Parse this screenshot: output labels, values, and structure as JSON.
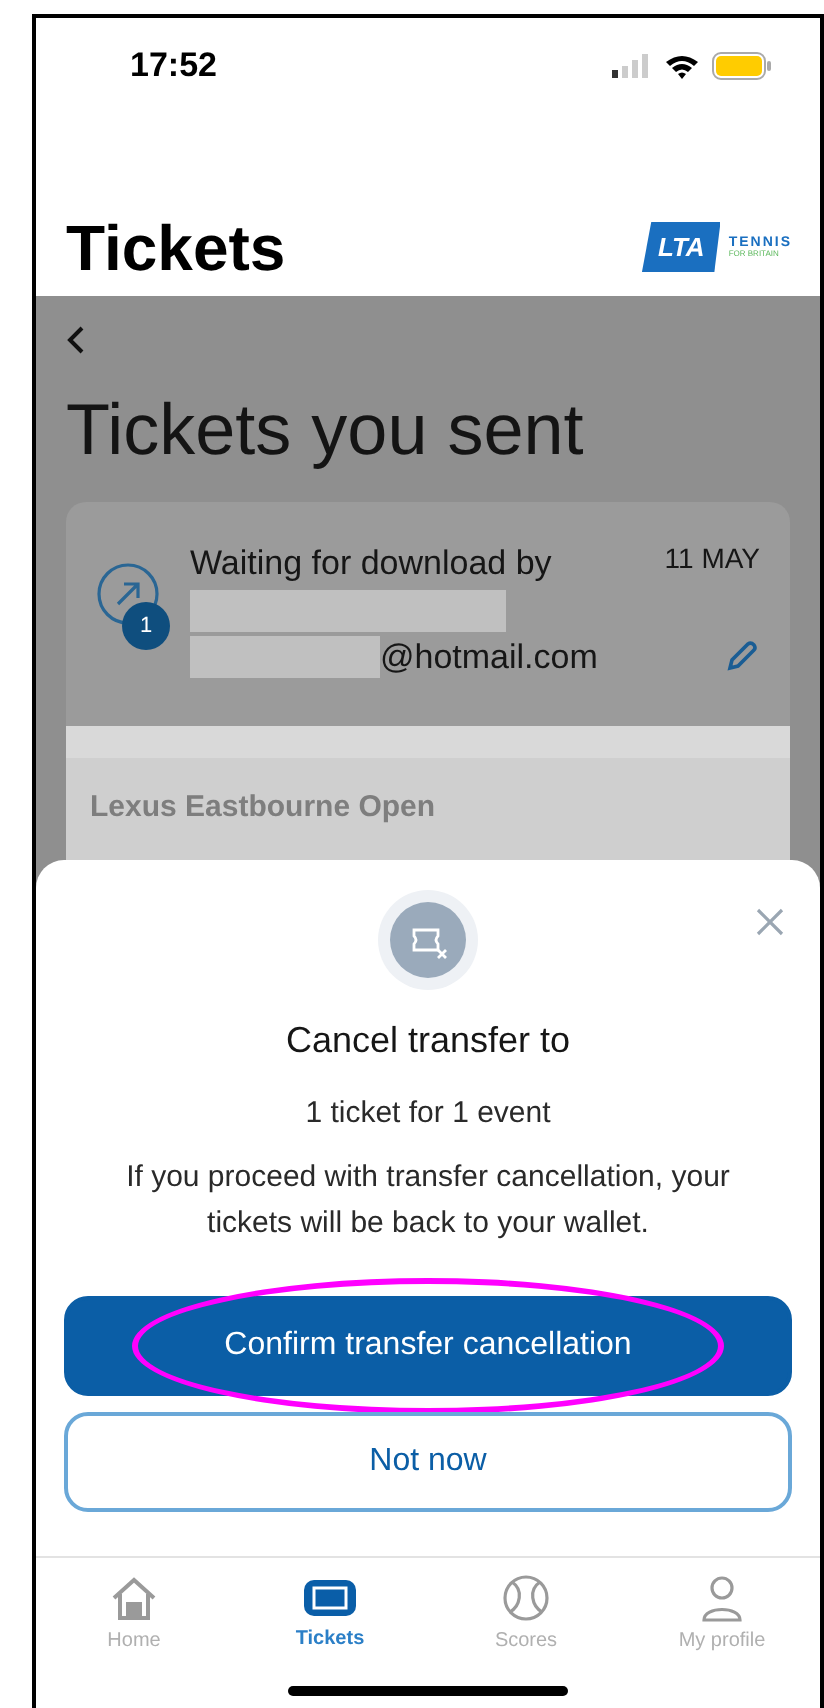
{
  "status_bar": {
    "time": "17:52"
  },
  "header": {
    "title": "Tickets",
    "logo": {
      "mark": "LTA",
      "name": "TENNIS",
      "tagline": "FOR BRITAIN"
    }
  },
  "page": {
    "title": "Tickets you sent"
  },
  "transfer": {
    "status": "Waiting for download by",
    "date": "11 MAY",
    "count": "1",
    "email_suffix": "@hotmail.com"
  },
  "event": {
    "name": "Lexus Eastbourne Open"
  },
  "sheet": {
    "title": "Cancel transfer to",
    "summary": "1 ticket for 1 event",
    "message": "If you proceed with transfer cancellation, your tickets will be back to your wallet.",
    "buttons": [
      {
        "kind": "primary",
        "label": "Confirm transfer cancellation",
        "highlighted": true
      },
      {
        "kind": "secondary",
        "label": "Not now",
        "highlighted": false
      }
    ]
  },
  "tabs": [
    {
      "kind": "home",
      "label": "Home",
      "selected": false
    },
    {
      "kind": "tickets",
      "label": "Tickets",
      "selected": true
    },
    {
      "kind": "scores",
      "label": "Scores",
      "selected": false
    },
    {
      "kind": "profile",
      "label": "My profile",
      "selected": false
    }
  ]
}
